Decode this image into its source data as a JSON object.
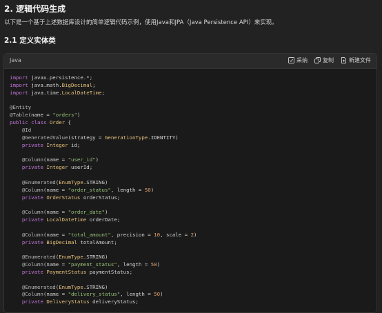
{
  "section_title": "2. 逻辑代码生成",
  "intro": "以下是一个基于上述数据库设计的简单逻辑代码示例，使用Java和JPA（Java Persistence API）来实现。",
  "subsection_title": "2.1 定义实体类",
  "code_block": {
    "language": "Java",
    "actions": {
      "adopt": "采纳",
      "copy": "复制",
      "new_file": "新建文件"
    },
    "lines": [
      [
        {
          "t": "import",
          "c": "kw"
        },
        {
          "t": " javax.persistence.*;",
          "c": "pl"
        }
      ],
      [
        {
          "t": "import",
          "c": "kw"
        },
        {
          "t": " java.math.",
          "c": "pl"
        },
        {
          "t": "BigDecimal",
          "c": "cls"
        },
        {
          "t": ";",
          "c": "pl"
        }
      ],
      [
        {
          "t": "import",
          "c": "kw"
        },
        {
          "t": " java.time.",
          "c": "pl"
        },
        {
          "t": "LocalDateTime",
          "c": "cls"
        },
        {
          "t": ";",
          "c": "pl"
        }
      ],
      [],
      [
        {
          "t": "@Entity",
          "c": "ann"
        }
      ],
      [
        {
          "t": "@Table",
          "c": "ann"
        },
        {
          "t": "(name = ",
          "c": "pl"
        },
        {
          "t": "\"orders\"",
          "c": "str"
        },
        {
          "t": ")",
          "c": "pl"
        }
      ],
      [
        {
          "t": "public",
          "c": "kw"
        },
        {
          "t": " ",
          "c": "pl"
        },
        {
          "t": "class",
          "c": "kw"
        },
        {
          "t": " ",
          "c": "pl"
        },
        {
          "t": "Order",
          "c": "cls"
        },
        {
          "t": " {",
          "c": "pl"
        }
      ],
      [
        {
          "t": "    @Id",
          "c": "ann"
        }
      ],
      [
        {
          "t": "    @GeneratedValue",
          "c": "ann"
        },
        {
          "t": "(strategy = ",
          "c": "pl"
        },
        {
          "t": "GenerationType",
          "c": "cls"
        },
        {
          "t": ".IDENTITY)",
          "c": "pl"
        }
      ],
      [
        {
          "t": "    ",
          "c": "pl"
        },
        {
          "t": "private",
          "c": "kw"
        },
        {
          "t": " ",
          "c": "pl"
        },
        {
          "t": "Integer",
          "c": "cls"
        },
        {
          "t": " id;",
          "c": "pl"
        }
      ],
      [],
      [
        {
          "t": "    @Column",
          "c": "ann"
        },
        {
          "t": "(name = ",
          "c": "pl"
        },
        {
          "t": "\"user_id\"",
          "c": "str"
        },
        {
          "t": ")",
          "c": "pl"
        }
      ],
      [
        {
          "t": "    ",
          "c": "pl"
        },
        {
          "t": "private",
          "c": "kw"
        },
        {
          "t": " ",
          "c": "pl"
        },
        {
          "t": "Integer",
          "c": "cls"
        },
        {
          "t": " userId;",
          "c": "pl"
        }
      ],
      [],
      [
        {
          "t": "    @Enumerated",
          "c": "ann"
        },
        {
          "t": "(",
          "c": "pl"
        },
        {
          "t": "EnumType",
          "c": "cls"
        },
        {
          "t": ".STRING)",
          "c": "pl"
        }
      ],
      [
        {
          "t": "    @Column",
          "c": "ann"
        },
        {
          "t": "(name = ",
          "c": "pl"
        },
        {
          "t": "\"order_status\"",
          "c": "str"
        },
        {
          "t": ", length = ",
          "c": "pl"
        },
        {
          "t": "50",
          "c": "num"
        },
        {
          "t": ")",
          "c": "pl"
        }
      ],
      [
        {
          "t": "    ",
          "c": "pl"
        },
        {
          "t": "private",
          "c": "kw"
        },
        {
          "t": " ",
          "c": "pl"
        },
        {
          "t": "OrderStatus",
          "c": "cls"
        },
        {
          "t": " orderStatus;",
          "c": "pl"
        }
      ],
      [],
      [
        {
          "t": "    @Column",
          "c": "ann"
        },
        {
          "t": "(name = ",
          "c": "pl"
        },
        {
          "t": "\"order_date\"",
          "c": "str"
        },
        {
          "t": ")",
          "c": "pl"
        }
      ],
      [
        {
          "t": "    ",
          "c": "pl"
        },
        {
          "t": "private",
          "c": "kw"
        },
        {
          "t": " ",
          "c": "pl"
        },
        {
          "t": "LocalDateTime",
          "c": "cls"
        },
        {
          "t": " orderDate;",
          "c": "pl"
        }
      ],
      [],
      [
        {
          "t": "    @Column",
          "c": "ann"
        },
        {
          "t": "(name = ",
          "c": "pl"
        },
        {
          "t": "\"total_amount\"",
          "c": "str"
        },
        {
          "t": ", precision = ",
          "c": "pl"
        },
        {
          "t": "10",
          "c": "num"
        },
        {
          "t": ", scale = ",
          "c": "pl"
        },
        {
          "t": "2",
          "c": "num"
        },
        {
          "t": ")",
          "c": "pl"
        }
      ],
      [
        {
          "t": "    ",
          "c": "pl"
        },
        {
          "t": "private",
          "c": "kw"
        },
        {
          "t": " ",
          "c": "pl"
        },
        {
          "t": "BigDecimal",
          "c": "cls"
        },
        {
          "t": " totalAmount;",
          "c": "pl"
        }
      ],
      [],
      [
        {
          "t": "    @Enumerated",
          "c": "ann"
        },
        {
          "t": "(",
          "c": "pl"
        },
        {
          "t": "EnumType",
          "c": "cls"
        },
        {
          "t": ".STRING)",
          "c": "pl"
        }
      ],
      [
        {
          "t": "    @Column",
          "c": "ann"
        },
        {
          "t": "(name = ",
          "c": "pl"
        },
        {
          "t": "\"payment_status\"",
          "c": "str"
        },
        {
          "t": ", length = ",
          "c": "pl"
        },
        {
          "t": "50",
          "c": "num"
        },
        {
          "t": ")",
          "c": "pl"
        }
      ],
      [
        {
          "t": "    ",
          "c": "pl"
        },
        {
          "t": "private",
          "c": "kw"
        },
        {
          "t": " ",
          "c": "pl"
        },
        {
          "t": "PaymentStatus",
          "c": "cls"
        },
        {
          "t": " paymentStatus;",
          "c": "pl"
        }
      ],
      [],
      [
        {
          "t": "    @Enumerated",
          "c": "ann"
        },
        {
          "t": "(",
          "c": "pl"
        },
        {
          "t": "EnumType",
          "c": "cls"
        },
        {
          "t": ".STRING)",
          "c": "pl"
        }
      ],
      [
        {
          "t": "    @Column",
          "c": "ann"
        },
        {
          "t": "(name = ",
          "c": "pl"
        },
        {
          "t": "\"delivery_status\"",
          "c": "str"
        },
        {
          "t": ", length = ",
          "c": "pl"
        },
        {
          "t": "50",
          "c": "num"
        },
        {
          "t": ")",
          "c": "pl"
        }
      ],
      [
        {
          "t": "    ",
          "c": "pl"
        },
        {
          "t": "private",
          "c": "kw"
        },
        {
          "t": " ",
          "c": "pl"
        },
        {
          "t": "DeliveryStatus",
          "c": "cls"
        },
        {
          "t": " deliveryStatus;",
          "c": "pl"
        }
      ]
    ]
  }
}
